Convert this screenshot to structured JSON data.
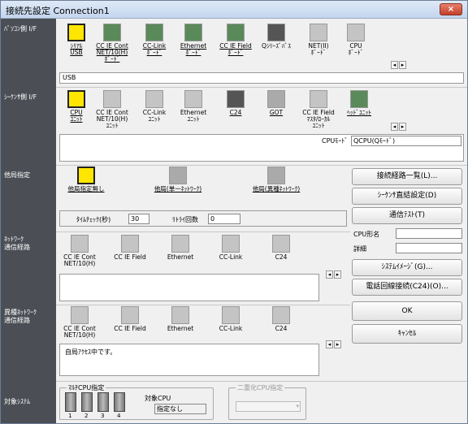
{
  "window": {
    "title": "接続先設定 Connection1",
    "close": "×"
  },
  "side": {
    "pc_if": "ﾊﾟｿｺﾝ側 I/F",
    "plc_if": "ｼｰｹﾝｻ側 I/F",
    "other_station": "他局指定",
    "network_route": "ﾈｯﾄﾜｰｸ\n通信経路",
    "hetero_route": "異種ﾈｯﾄﾜｰｸ\n通信経路",
    "target_system": "対象ｼｽﾃﾑ"
  },
  "pc_if": {
    "devices": [
      {
        "label": "ｼﾘｱﾙ\nUSB",
        "icon": "serial-usb-icon",
        "selected": true
      },
      {
        "label": "CC IE Cont\nNET/10(H)\nﾎﾞｰﾄﾞ",
        "icon": "board-icon"
      },
      {
        "label": "CC-Link\nﾎﾞｰﾄﾞ",
        "icon": "board-icon"
      },
      {
        "label": "Ethernet\nﾎﾞｰﾄﾞ",
        "icon": "board-icon"
      },
      {
        "label": "CC IE Field\nﾎﾞｰﾄﾞ",
        "icon": "board-icon"
      },
      {
        "label": "Qｼﾘｰｽﾞﾊﾞｽ",
        "icon": "bus-icon"
      },
      {
        "label": "NET(II)\nﾎﾞｰﾄﾞ",
        "icon": "board-icon"
      },
      {
        "label": "CPU\nﾎﾞｰﾄﾞ",
        "icon": "board-icon"
      }
    ],
    "detail": "USB"
  },
  "plc_if": {
    "devices": [
      {
        "label": "CPU\nﾕﾆｯﾄ",
        "selected": true
      },
      {
        "label": "CC IE Cont\nNET/10(H)\nﾕﾆｯﾄ"
      },
      {
        "label": "CC-Link\nﾕﾆｯﾄ"
      },
      {
        "label": "Ethernet\nﾕﾆｯﾄ"
      },
      {
        "label": "C24"
      },
      {
        "label": "GOT"
      },
      {
        "label": "CC IE Field\nﾏｽﾀ/ﾛｰｶﾙ\nﾕﾆｯﾄ"
      },
      {
        "label": "ﾍｯﾄﾞﾕﾆｯﾄ"
      }
    ],
    "cpu_mode_label": "CPUﾓｰﾄﾞ",
    "cpu_mode_value": "QCPU(Qﾓｰﾄﾞ)"
  },
  "other_station": {
    "options": [
      "他局指定無し",
      "他局(単一ﾈｯﾄﾜｰｸ)",
      "他局(異種ﾈｯﾄﾜｰｸ)"
    ],
    "timecheck_label": "ﾀｲﾑﾁｪｯｸ(秒)",
    "timecheck_value": "30",
    "retry_label": "ﾘﾄﾗｲ回数",
    "retry_value": "0"
  },
  "network_route": {
    "items": [
      "CC IE Cont\nNET/10(H)",
      "CC IE Field",
      "Ethernet",
      "CC-Link",
      "C24"
    ]
  },
  "hetero_route": {
    "items": [
      "CC IE Cont\nNET/10(H)",
      "CC IE Field",
      "Ethernet",
      "CC-Link",
      "C24"
    ],
    "message": "自局ｱｸｾｽ中です。"
  },
  "target_system": {
    "multi_cpu_label": "ﾏﾙﾁCPU指定",
    "cpu_numbers": [
      "1",
      "2",
      "3",
      "4"
    ],
    "target_cpu_label": "対象CPU",
    "target_cpu_value": "指定なし",
    "redundant_label": "二重化CPU指定"
  },
  "buttons": {
    "route_list": "接続経路一覧(L)...",
    "plc_direct": "ｼｰｹﾝｻ直結設定(D)",
    "comm_test": "通信ﾃｽﾄ(T)",
    "cpu_model_label": "CPU形名",
    "detail_label": "詳細",
    "system_image": "ｼｽﾃﾑｲﾒｰｼﾞ(G)...",
    "phone_line": "電話回線接続(C24)(O)...",
    "ok": "OK",
    "cancel": "ｷｬﾝｾﾙ"
  }
}
